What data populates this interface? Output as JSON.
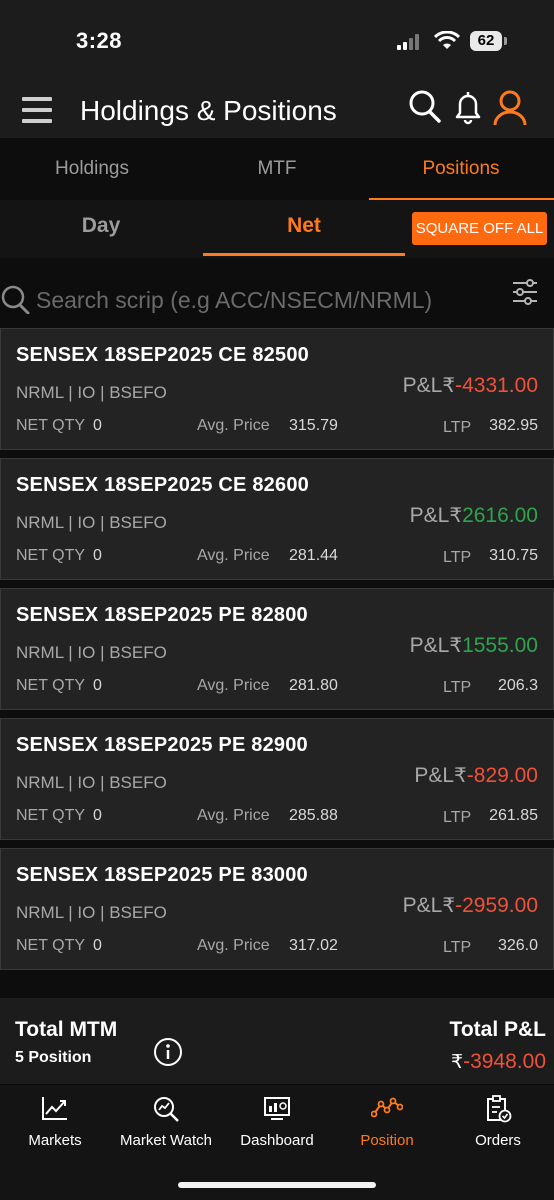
{
  "status": {
    "time": "3:28",
    "battery": "62"
  },
  "header": {
    "title": "Holdings & Positions"
  },
  "tabs": [
    {
      "label": "Holdings"
    },
    {
      "label": "MTF"
    },
    {
      "label": "Positions"
    }
  ],
  "subtabs": {
    "day": "Day",
    "net": "Net",
    "square_off": "SQUARE OFF ALL"
  },
  "search": {
    "placeholder": "Search scrip (e.g ACC/NSECM/NRML)"
  },
  "positions": [
    {
      "name": "SENSEX 18SEP2025 CE 82500",
      "meta": "NRML | IO |  BSEFO",
      "pnl_label": "P&L",
      "currency": "₹",
      "pnl": "-4331.00",
      "pnl_sign": "negative",
      "qty_label": "NET QTY",
      "qty": "0",
      "avg_label": "Avg. Price",
      "avg": "315.79",
      "ltp_label": "LTP",
      "ltp": "382.95"
    },
    {
      "name": "SENSEX 18SEP2025 CE 82600",
      "meta": "NRML | IO |  BSEFO",
      "pnl_label": "P&L",
      "currency": "₹",
      "pnl": "2616.00",
      "pnl_sign": "positive",
      "qty_label": "NET QTY",
      "qty": "0",
      "avg_label": "Avg. Price",
      "avg": "281.44",
      "ltp_label": "LTP",
      "ltp": "310.75"
    },
    {
      "name": "SENSEX 18SEP2025 PE 82800",
      "meta": "NRML | IO |  BSEFO",
      "pnl_label": "P&L",
      "currency": "₹",
      "pnl": "1555.00",
      "pnl_sign": "positive",
      "qty_label": "NET QTY",
      "qty": "0",
      "avg_label": "Avg. Price",
      "avg": "281.80",
      "ltp_label": "LTP",
      "ltp": "206.3"
    },
    {
      "name": "SENSEX 18SEP2025 PE 82900",
      "meta": "NRML | IO |  BSEFO",
      "pnl_label": "P&L",
      "currency": "₹",
      "pnl": "-829.00",
      "pnl_sign": "negative",
      "qty_label": "NET QTY",
      "qty": "0",
      "avg_label": "Avg. Price",
      "avg": "285.88",
      "ltp_label": "LTP",
      "ltp": "261.85"
    },
    {
      "name": "SENSEX 18SEP2025 PE 83000",
      "meta": "NRML | IO |  BSEFO",
      "pnl_label": "P&L",
      "currency": "₹",
      "pnl": "-2959.00",
      "pnl_sign": "negative",
      "qty_label": "NET QTY",
      "qty": "0",
      "avg_label": "Avg. Price",
      "avg": "317.02",
      "ltp_label": "LTP",
      "ltp": "326.0"
    }
  ],
  "totals": {
    "mtm_label": "Total MTM",
    "position_count": "5 Position",
    "pnl_label": "Total P&L",
    "currency": "₹",
    "pnl": "-3948.00"
  },
  "nav": [
    {
      "label": "Markets",
      "icon": "chart-line-icon"
    },
    {
      "label": "Market Watch",
      "icon": "magnify-chart-icon"
    },
    {
      "label": "Dashboard",
      "icon": "dashboard-icon"
    },
    {
      "label": "Position",
      "icon": "position-line-icon"
    },
    {
      "label": "Orders",
      "icon": "orders-clipboard-icon"
    }
  ],
  "colors": {
    "accent": "#ff7a1a",
    "negative": "#f0513a",
    "positive": "#2ea44f",
    "card_bg": "#232323"
  }
}
